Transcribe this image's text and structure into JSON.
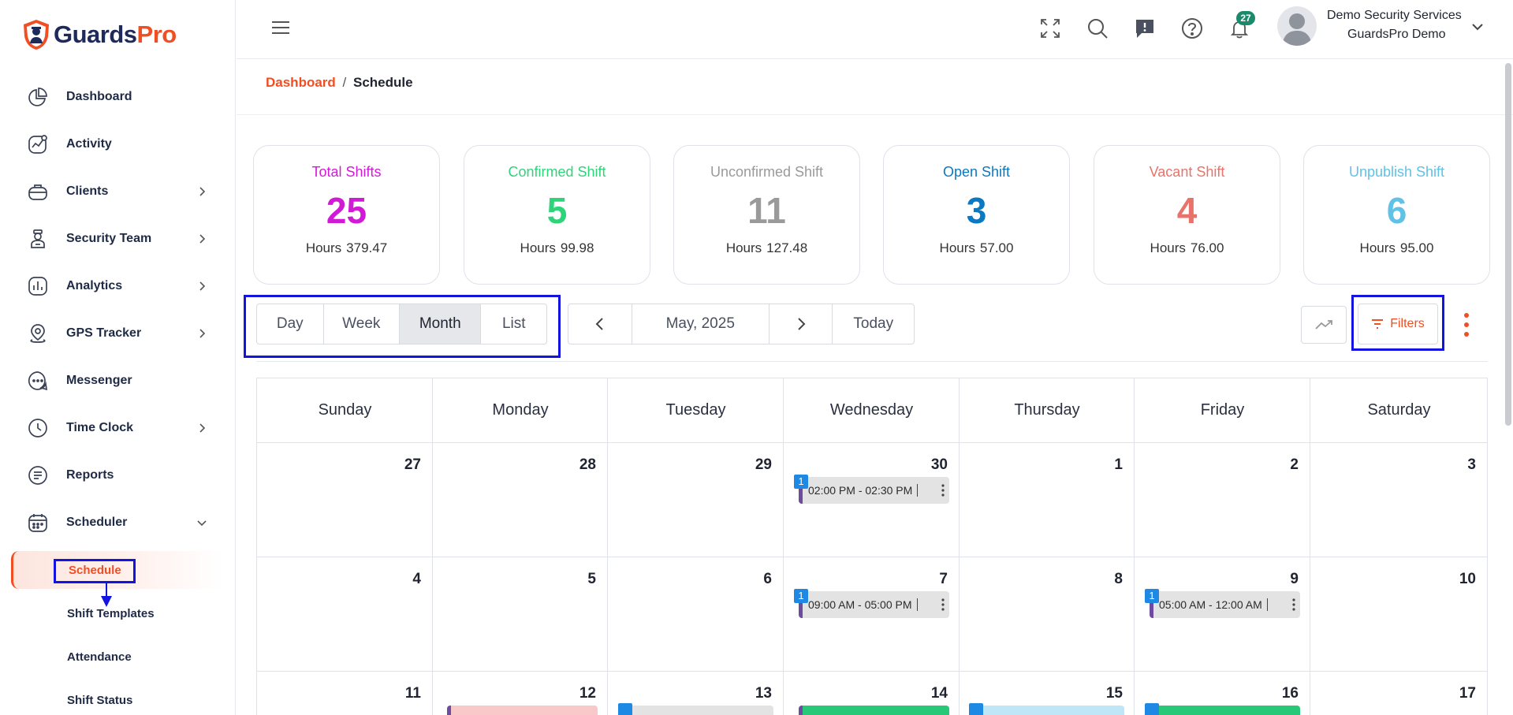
{
  "brand": {
    "part1": "Guards",
    "part2": "Pro"
  },
  "sidebar": {
    "items": [
      {
        "label": "Dashboard"
      },
      {
        "label": "Activity"
      },
      {
        "label": "Clients"
      },
      {
        "label": "Security Team"
      },
      {
        "label": "Analytics"
      },
      {
        "label": "GPS Tracker"
      },
      {
        "label": "Messenger"
      },
      {
        "label": "Time Clock"
      },
      {
        "label": "Reports"
      },
      {
        "label": "Scheduler"
      }
    ],
    "subitems": [
      {
        "label": "Schedule"
      },
      {
        "label": "Shift Templates"
      },
      {
        "label": "Attendance"
      },
      {
        "label": "Shift Status"
      }
    ]
  },
  "topbar": {
    "notification_count": "27",
    "user_name": "Demo Security Services",
    "user_org": "GuardsPro Demo"
  },
  "breadcrumb": {
    "parent": "Dashboard",
    "separator": "/",
    "current": "Schedule"
  },
  "stats": [
    {
      "title": "Total Shifts",
      "value": "25",
      "hours_label": "Hours",
      "hours": "379.47",
      "color": "#d11ad6"
    },
    {
      "title": "Confirmed Shift",
      "value": "5",
      "hours_label": "Hours",
      "hours": "99.98",
      "color": "#2ed47a"
    },
    {
      "title": "Unconfirmed Shift",
      "value": "11",
      "hours_label": "Hours",
      "hours": "127.48",
      "color": "#9a9a9a"
    },
    {
      "title": "Open Shift",
      "value": "3",
      "hours_label": "Hours",
      "hours": "57.00",
      "color": "#0b78c2"
    },
    {
      "title": "Vacant Shift",
      "value": "4",
      "hours_label": "Hours",
      "hours": "76.00",
      "color": "#e8736b"
    },
    {
      "title": "Unpublish Shift",
      "value": "6",
      "hours_label": "Hours",
      "hours": "95.00",
      "color": "#5fc2e6"
    }
  ],
  "views": {
    "day": "Day",
    "week": "Week",
    "month": "Month",
    "list": "List",
    "active": "Month"
  },
  "period": {
    "label": "May, 2025",
    "today": "Today"
  },
  "filters_label": "Filters",
  "calendar": {
    "weekdays": [
      "Sunday",
      "Monday",
      "Tuesday",
      "Wednesday",
      "Thursday",
      "Friday",
      "Saturday"
    ],
    "weeks": [
      [
        "27",
        "28",
        "29",
        "30",
        "1",
        "2",
        "3"
      ],
      [
        "4",
        "5",
        "6",
        "7",
        "8",
        "9",
        "10"
      ],
      [
        "11",
        "12",
        "13",
        "14",
        "15",
        "16",
        "17"
      ]
    ],
    "events": [
      {
        "time": "02:00 PM - 02:30 PM",
        "badge": "1"
      },
      {
        "time": "09:00 AM - 05:00 PM",
        "badge": "1"
      },
      {
        "time": "05:00 AM - 12:00 AM",
        "badge": "1"
      }
    ]
  }
}
